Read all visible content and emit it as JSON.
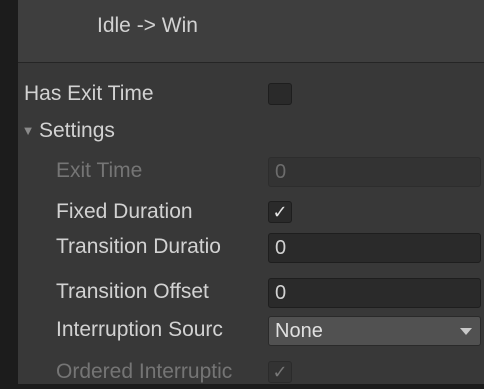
{
  "header": {
    "title": "Idle -> Win"
  },
  "fields": {
    "has_exit_time": {
      "label": "Has Exit Time",
      "checked": false
    },
    "settings": {
      "label": "Settings",
      "toggle_glyph": "▼",
      "expanded": true
    },
    "exit_time": {
      "label": "Exit Time",
      "value": "0",
      "enabled": false
    },
    "fixed_duration": {
      "label": "Fixed Duration",
      "checked": true,
      "check_glyph": "✓"
    },
    "transition_duration": {
      "label": "Transition Duratio",
      "value": "0"
    },
    "transition_offset": {
      "label": "Transition Offset",
      "value": "0"
    },
    "interruption_source": {
      "label": "Interruption Sourc",
      "value": "None"
    },
    "ordered_interruption": {
      "label": "Ordered Interruptic",
      "checked": true,
      "check_glyph": "✓",
      "enabled": false
    }
  },
  "colors": {
    "panel": "#383838",
    "header": "#3e3e3e",
    "text": "#d2d2d2",
    "text_disabled": "#757575"
  }
}
